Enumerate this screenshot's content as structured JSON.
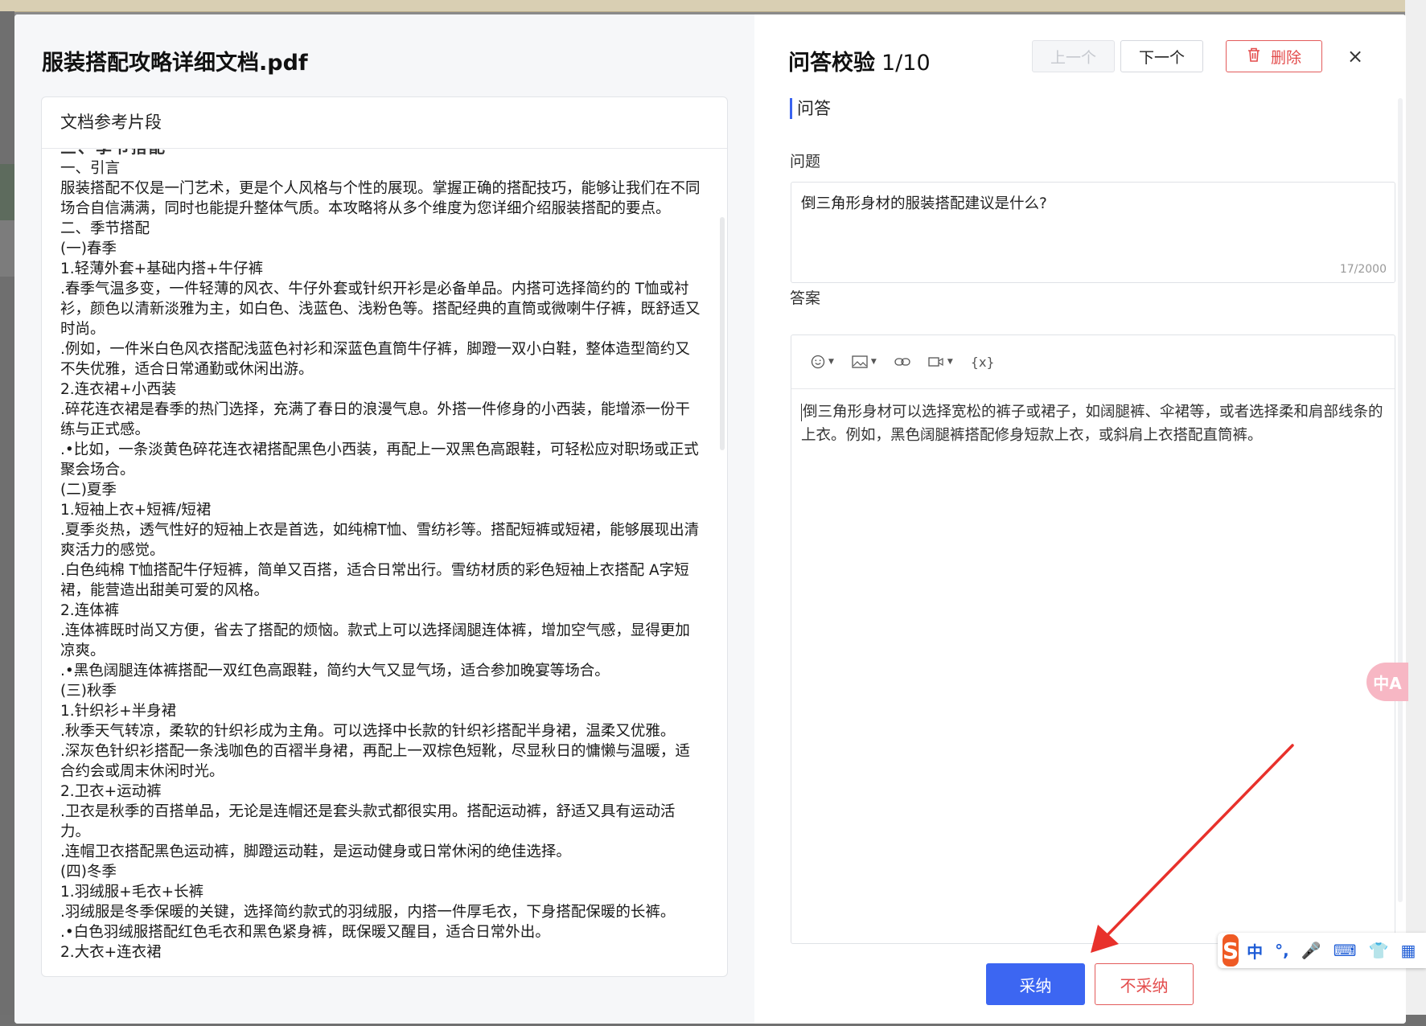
{
  "document": {
    "title": "服装搭配攻略详细文档.pdf",
    "snippet_header": "文档参考片段",
    "cut_off_line": "三、季节搭配",
    "lines": [
      "一、引言",
      "服装搭配不仅是一门艺术，更是个人风格与个性的展现。掌握正确的搭配技巧，能够让我们在不同场合自信满满，同时也能提升整体气质。本攻略将从多个维度为您详细介绍服装搭配的要点。",
      "二、季节搭配",
      "(一)春季",
      "1.轻薄外套+基础内搭+牛仔裤",
      ".春季气温多变，一件轻薄的风衣、牛仔外套或针织开衫是必备单品。内搭可选择简约的 T恤或衬衫，颜色以清新淡雅为主，如白色、浅蓝色、浅粉色等。搭配经典的直筒或微喇牛仔裤，既舒适又时尚。",
      ".例如，一件米白色风衣搭配浅蓝色衬衫和深蓝色直筒牛仔裤，脚蹬一双小白鞋，整体造型简约又不失优雅，适合日常通勤或休闲出游。",
      "2.连衣裙+小西装",
      ".碎花连衣裙是春季的热门选择，充满了春日的浪漫气息。外搭一件修身的小西装，能增添一份干练与正式感。",
      ".•比如，一条淡黄色碎花连衣裙搭配黑色小西装，再配上一双黑色高跟鞋，可轻松应对职场或正式聚会场合。",
      "(二)夏季",
      "1.短袖上衣+短裤/短裙",
      ".夏季炎热，透气性好的短袖上衣是首选，如纯棉T恤、雪纺衫等。搭配短裤或短裙，能够展现出清爽活力的感觉。",
      ".白色纯棉 T恤搭配牛仔短裤，简单又百搭，适合日常出行。雪纺材质的彩色短袖上衣搭配 A字短裙，能营造出甜美可爱的风格。",
      "2.连体裤",
      ".连体裤既时尚又方便，省去了搭配的烦恼。款式上可以选择阔腿连体裤，增加空气感，显得更加凉爽。",
      ".•黑色阔腿连体裤搭配一双红色高跟鞋，简约大气又显气场，适合参加晚宴等场合。",
      "(三)秋季",
      "1.针织衫+半身裙",
      ".秋季天气转凉，柔软的针织衫成为主角。可以选择中长款的针织衫搭配半身裙，温柔又优雅。",
      ".深灰色针织衫搭配一条浅咖色的百褶半身裙，再配上一双棕色短靴，尽显秋日的慵懒与温暖，适合约会或周末休闲时光。",
      "2.卫衣+运动裤",
      ".卫衣是秋季的百搭单品，无论是连帽还是套头款式都很实用。搭配运动裤，舒适又具有运动活力。",
      ".连帽卫衣搭配黑色运动裤，脚蹬运动鞋，是运动健身或日常休闲的绝佳选择。",
      "(四)冬季",
      "1.羽绒服+毛衣+长裤",
      ".羽绒服是冬季保暖的关键，选择简约款式的羽绒服，内搭一件厚毛衣，下身搭配保暖的长裤。",
      ".•白色羽绒服搭配红色毛衣和黑色紧身裤，既保暖又醒目，适合日常外出。",
      "2.大衣+连衣裙"
    ]
  },
  "qa": {
    "title": "问答校验",
    "counter": "1/10",
    "prev_label": "上一个",
    "next_label": "下一个",
    "delete_label": "删除",
    "close_glyph": "×",
    "section_label": "问答",
    "question_label": "问题",
    "question_text": "倒三角形身材的服装搭配建议是什么?",
    "question_count": "17/2000",
    "answer_label": "答案",
    "answer_text": "倒三角形身材可以选择宽松的裤子或裙子，如阔腿裤、伞裙等，或者选择柔和肩部线条的上衣。例如，黑色阔腿裤搭配修身短款上衣，或斜肩上衣搭配直筒裤。",
    "toolbar": {
      "var_label": "{x}",
      "icons": [
        "emoji-icon",
        "image-icon",
        "link-icon",
        "video-icon",
        "variable-icon"
      ]
    },
    "accept_label": "采纳",
    "reject_label": "不采纳"
  },
  "overlays": {
    "translate_glyph": "中A",
    "ime": {
      "logo": "S",
      "items": [
        "中",
        "°,",
        "🎤",
        "⌨",
        "👕",
        "▦"
      ]
    }
  },
  "colors": {
    "accent": "#3c66f2",
    "danger": "#e34b4b",
    "arrow": "#e8312b"
  }
}
